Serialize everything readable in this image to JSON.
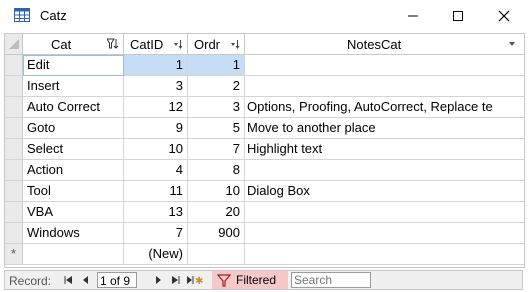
{
  "window": {
    "title": "Catz"
  },
  "columns": {
    "cat": "Cat",
    "catid": "CatID",
    "ordr": "Ordr",
    "notes": "NotesCat"
  },
  "rows": [
    {
      "cat": "Edit",
      "catid": "1",
      "ordr": "1",
      "notes": ""
    },
    {
      "cat": "Insert",
      "catid": "3",
      "ordr": "2",
      "notes": ""
    },
    {
      "cat": "Auto Correct",
      "catid": "12",
      "ordr": "3",
      "notes": "Options, Proofing, AutoCorrect, Replace te"
    },
    {
      "cat": "Goto",
      "catid": "9",
      "ordr": "5",
      "notes": "Move to another place"
    },
    {
      "cat": "Select",
      "catid": "10",
      "ordr": "7",
      "notes": "Highlight text"
    },
    {
      "cat": "Action",
      "catid": "4",
      "ordr": "8",
      "notes": ""
    },
    {
      "cat": "Tool",
      "catid": "11",
      "ordr": "10",
      "notes": "Dialog Box"
    },
    {
      "cat": "VBA",
      "catid": "13",
      "ordr": "20",
      "notes": ""
    },
    {
      "cat": "Windows",
      "catid": "7",
      "ordr": "900",
      "notes": ""
    }
  ],
  "new_row": {
    "marker": "*",
    "catid": "(New)"
  },
  "navigation": {
    "record_label": "Record:",
    "position": "1 of 9",
    "filter_label": "Filtered",
    "search_placeholder": "Search"
  },
  "icons": {
    "window_icon": "table-icon",
    "minimize": "minimize-icon",
    "maximize": "maximize-icon",
    "close": "close-icon",
    "filter": "filter-icon"
  },
  "colors": {
    "selection": "#c6ddf6",
    "filtered_bg": "#f6c8c8",
    "selector_bg": "#eaeaea"
  }
}
